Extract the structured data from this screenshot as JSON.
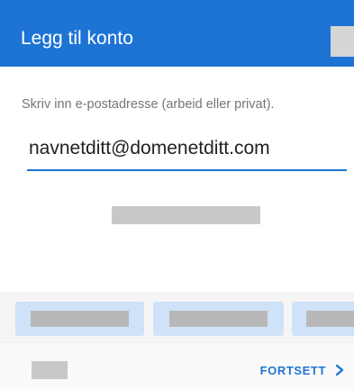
{
  "app_bar": {
    "title": "Legg til konto"
  },
  "form": {
    "instruction": "Skriv inn e-postadresse (arbeid eller privat).",
    "email_value": "navnetditt@domenetditt.com"
  },
  "footer": {
    "continue_label": "FORTSETT",
    "continue_icon": "chevron-right-icon"
  },
  "colors": {
    "accent": "#1e74d5",
    "chip_background": "#cfe2f7",
    "redacted_gray": "#c8c8c8"
  }
}
